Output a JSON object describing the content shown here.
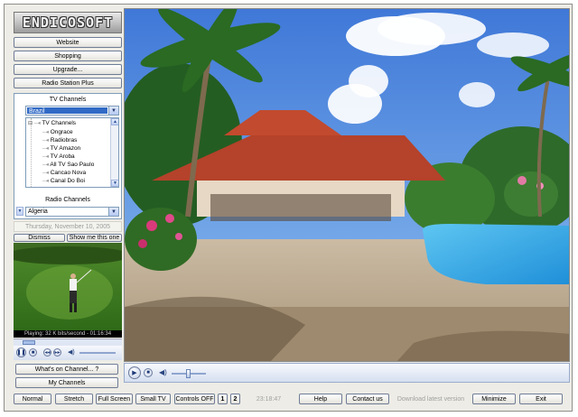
{
  "app": {
    "logo_text": "ENDICOSOFT"
  },
  "links": {
    "website": "Website",
    "shopping": "Shopping",
    "upgrade": "Upgrade...",
    "radio_station_plus": "Radio Station Plus"
  },
  "tv_channels": {
    "header": "TV Channels",
    "selected_country": "Brazil",
    "tree_root": "TV Channels",
    "items": [
      "Ongrace",
      "Radiobras",
      "TV Amazon",
      "TV Aroba",
      "All TV Sao Paulo",
      "Cancao Nova",
      "Canal Do Boi"
    ]
  },
  "radio_channels": {
    "header": "Radio Channels",
    "selected_country": "Algeria"
  },
  "date_text": "Thursday, November 10, 2005",
  "notice": {
    "dismiss": "Dismiss",
    "show_me": "Show me this one"
  },
  "preview": {
    "status": "Playing: 32 K bits/second - 01:16:34"
  },
  "buttons": {
    "whats_on": "What's on Channel... ?",
    "my_channels": "My Channels"
  },
  "bottom_bar": {
    "normal": "Normal",
    "stretch": "Stretch",
    "full_screen": "Full Screen",
    "small_tv": "Small TV",
    "controls_off": "Controls OFF",
    "page_1": "1",
    "page_2": "2",
    "clock": "23:18:47",
    "help": "Help",
    "contact_us": "Contact us",
    "download_latest": "Download latest version",
    "minimize": "Minimize",
    "exit": "Exit"
  },
  "icons": {
    "play": "play-icon",
    "stop": "stop-icon",
    "rewind": "rewind-icon",
    "forward": "forward-icon",
    "volume": "speaker-icon",
    "expand": "plus-expander-icon",
    "tree_arrow": "dropdown-arrow-icon"
  },
  "colors": {
    "frame_bg": "#edece6",
    "selection": "#316ac5",
    "button_border": "#6f7c96"
  }
}
